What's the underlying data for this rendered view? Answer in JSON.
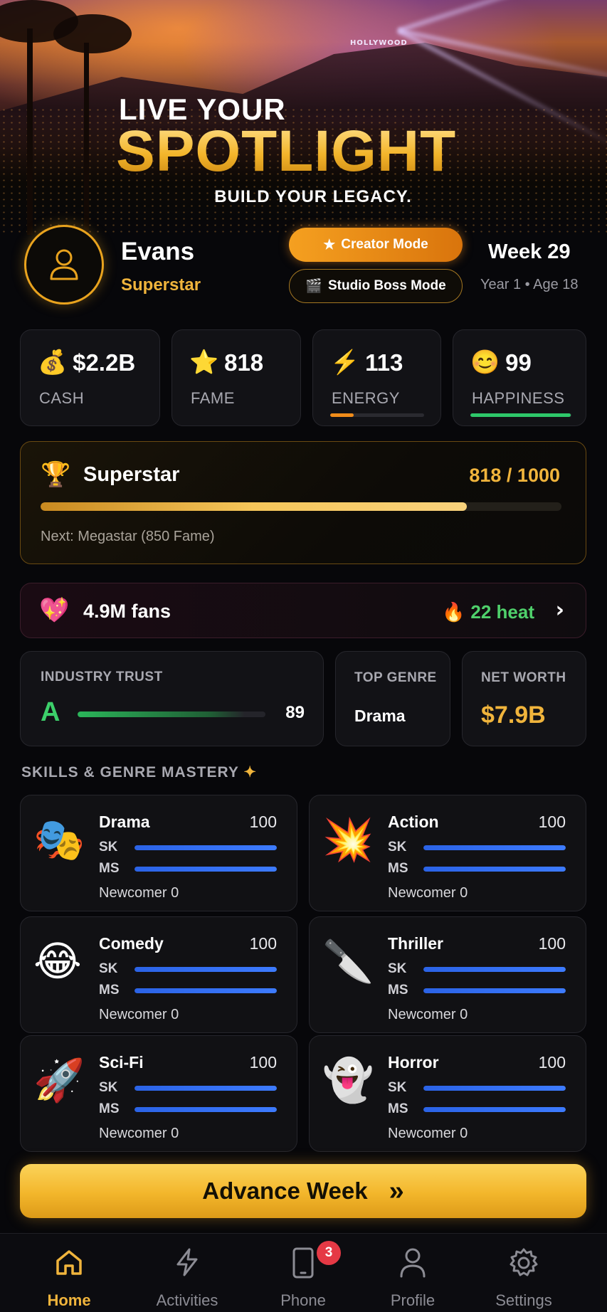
{
  "hero": {
    "line1": "LIVE YOUR",
    "line2": "SPOTLIGHT",
    "line3": "BUILD YOUR LEGACY.",
    "sign": "HOLLYWOOD"
  },
  "profile": {
    "name": "Evans",
    "rank": "Superstar",
    "avatar_icon": "user-icon",
    "creator_mode": "Creator Mode",
    "studio_mode": "Studio Boss Mode",
    "week": "Week 29",
    "year_age": "Year 1 • Age 18"
  },
  "stats": [
    {
      "icon": "💰",
      "value": "$2.2B",
      "label": "CASH"
    },
    {
      "icon": "⭐",
      "value": "818",
      "label": "FAME"
    },
    {
      "icon": "⚡",
      "value": "113",
      "label": "ENERGY",
      "bar_fraction": 0.25,
      "bar_color": "#f08c1a"
    },
    {
      "icon": "😊",
      "value": "99",
      "label": "HAPPINESS",
      "bar_fraction": 0.99,
      "bar_color": "#2ec86a"
    }
  ],
  "fame_card": {
    "icon": "🏆",
    "title": "Superstar",
    "progress_text": "818 / 1000",
    "progress_fraction": 0.818,
    "next": "Next: Megastar (850 Fame)"
  },
  "fans": {
    "icon": "💖",
    "text": "4.9M fans",
    "heat_icon": "🔥",
    "heat": "22 heat",
    "chevron": "›"
  },
  "industry": {
    "trust_label": "INDUSTRY TRUST",
    "trust_grade": "A",
    "trust_value": "89",
    "trust_fraction": 0.89,
    "genre_label": "TOP GENRE",
    "genre_value": "Drama",
    "networth_label": "NET WORTH",
    "networth_value": "$7.9B"
  },
  "skills_title": "SKILLS & GENRE MASTERY",
  "skills": [
    {
      "emoji": "🎭",
      "name": "Drama",
      "score": "100",
      "sk": "SK",
      "ms": "MS",
      "level": "Newcomer 0"
    },
    {
      "emoji": "💥",
      "name": "Action",
      "score": "100",
      "sk": "SK",
      "ms": "MS",
      "level": "Newcomer 0"
    },
    {
      "emoji": "😂",
      "name": "Comedy",
      "score": "100",
      "sk": "SK",
      "ms": "MS",
      "level": "Newcomer 0"
    },
    {
      "emoji": "🔪",
      "name": "Thriller",
      "score": "100",
      "sk": "SK",
      "ms": "MS",
      "level": "Newcomer 0"
    },
    {
      "emoji": "🚀",
      "name": "Sci-Fi",
      "score": "100",
      "sk": "SK",
      "ms": "MS",
      "level": "Newcomer 0"
    },
    {
      "emoji": "👻",
      "name": "Horror",
      "score": "100",
      "sk": "SK",
      "ms": "MS",
      "level": "Newcomer 0"
    }
  ],
  "advance_label": "Advance Week",
  "advance_icon": "»",
  "nav": {
    "home": "Home",
    "activities": "Activities",
    "phone": "Phone",
    "phone_badge": "3",
    "profile": "Profile",
    "settings": "Settings"
  },
  "colors": {
    "accent": "#f0b43c",
    "active_nav": "#f0b43c",
    "skill_bar": "#3d7bff"
  }
}
